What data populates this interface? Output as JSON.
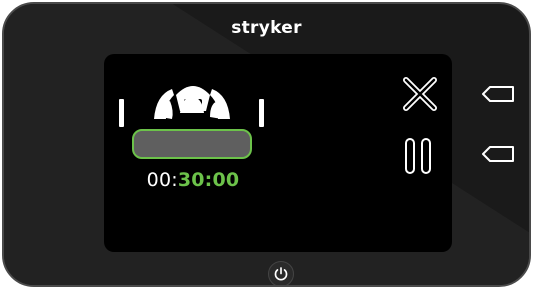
{
  "brand": {
    "logo_text": "stryker"
  },
  "timer": {
    "hours": "00:",
    "minutes_seconds": "30:00"
  },
  "icons": {
    "bed_position": "bed-position-icon",
    "cancel": "close-icon",
    "pause": "pause-icon",
    "side_button_top": "side-button-icon",
    "side_button_bottom": "side-button-icon",
    "power": "power-icon"
  },
  "colors": {
    "accent_green": "#6cc24a",
    "panel": "#1a1a1a",
    "screen": "#000000"
  }
}
